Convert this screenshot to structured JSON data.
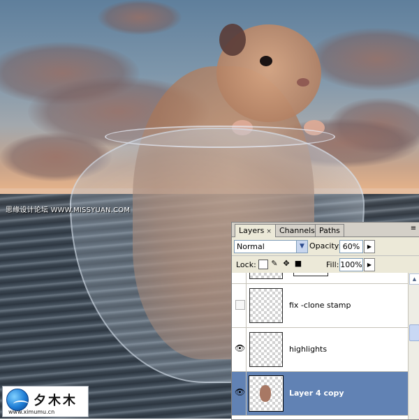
{
  "watermarks": {
    "mid_text": "思缘设计论坛 WWW.MISSYUAN.COM",
    "logo_text": "夕木木",
    "logo_url": "www.ximumu.cn"
  },
  "panel": {
    "tabs": [
      {
        "label": "Layers",
        "close": "×",
        "active": true
      },
      {
        "label": "Channels",
        "active": false
      },
      {
        "label": "Paths",
        "active": false
      }
    ],
    "menu_icon": "≡",
    "blend_mode": "Normal",
    "opacity_label": "Opacity:",
    "opacity_value": "60%",
    "lock_label": "Lock:",
    "fill_label": "Fill:",
    "fill_value": "100%",
    "layers": [
      {
        "name": "fix -clone stamp",
        "visible": false,
        "selected": false
      },
      {
        "name": "highlights",
        "visible": true,
        "selected": false
      },
      {
        "name": "Layer 4 copy",
        "visible": true,
        "selected": true
      }
    ]
  },
  "colors": {
    "selected_layer": "#6182b4",
    "panel_bg": "#ece9d8"
  },
  "icons": [
    "eye-icon",
    "lock-transparent-icon",
    "lock-paint-icon",
    "lock-move-icon",
    "lock-all-icon",
    "dropdown-arrow-icon",
    "panel-menu-icon",
    "scroll-up-icon"
  ]
}
